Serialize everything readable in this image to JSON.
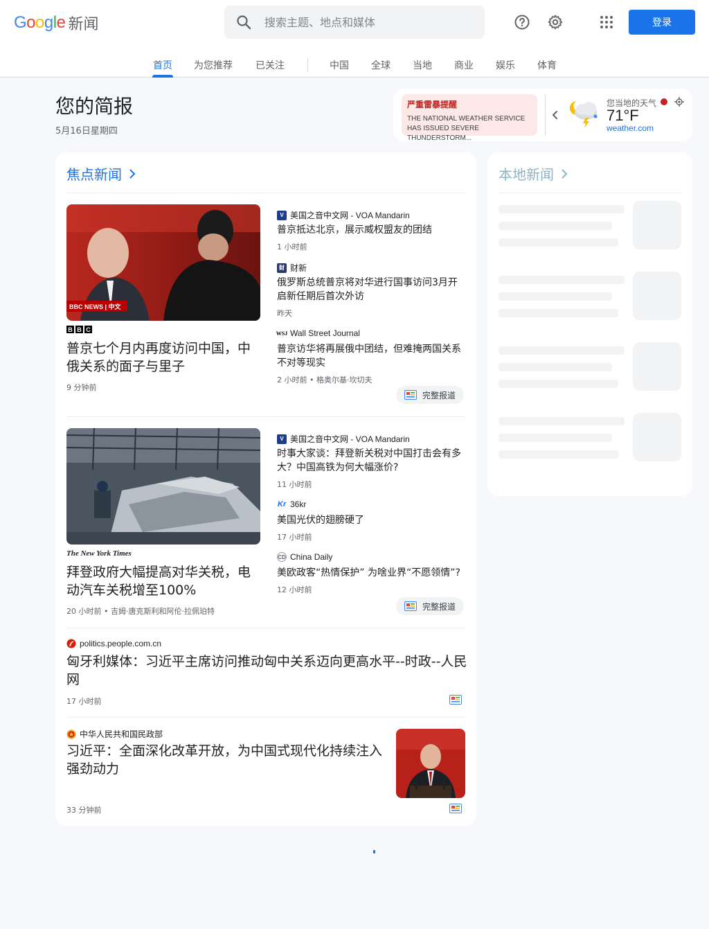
{
  "brand": {
    "google": "Google",
    "product": "新闻"
  },
  "search": {
    "placeholder": "搜索主题、地点和媒体"
  },
  "header": {
    "signin_label": "登录"
  },
  "tabs": [
    {
      "label": "首页",
      "active": true
    },
    {
      "label": "为您推荐"
    },
    {
      "label": "已关注"
    },
    {
      "label": "中国"
    },
    {
      "label": "全球"
    },
    {
      "label": "当地"
    },
    {
      "label": "商业"
    },
    {
      "label": "娱乐"
    },
    {
      "label": "体育"
    }
  ],
  "briefing": {
    "title": "您的简报",
    "date": "5月16日星期四"
  },
  "weather": {
    "alert_title": "严重雷暴提醒",
    "alert_desc": "THE NATIONAL WEATHER SERVICE HAS ISSUED SEVERE THUNDERSTORM...",
    "label": "您当地的天气",
    "temp": "71°F",
    "source": "weather.com"
  },
  "top_stories": {
    "heading": "焦点新闻",
    "full_coverage_label": "完整报道",
    "clusters": [
      {
        "main": {
          "publisher": "BBC",
          "title": "普京七个月内再度访问中国，中俄关系的面子与里子",
          "time": "9 分钟前",
          "image_caption": "BBC NEWS | 中文"
        },
        "related": [
          {
            "publisher": "美国之音中文网 - VOA Mandarin",
            "title": "普京抵达北京，展示威权盟友的团结",
            "meta": "1 小时前"
          },
          {
            "publisher": "财新",
            "title": "俄罗斯总统普京将对华进行国事访问3月开启新任期后首次外访",
            "meta": "昨天"
          },
          {
            "publisher": "Wall Street Journal",
            "title": "普京访华将再展俄中团结，但难掩两国关系不对等现实",
            "meta": "2 小时前 • 格奥尔基·坎切夫"
          }
        ]
      },
      {
        "main": {
          "publisher": "The New York Times",
          "title": "拜登政府大幅提高对华关税，电动汽车关税增至100%",
          "time": "20 小时前 • 吉姆·唐克斯利和阿伦·拉佩珀特"
        },
        "related": [
          {
            "publisher": "美国之音中文网 - VOA Mandarin",
            "title": "时事大家谈：拜登新关税对中国打击会有多大？中国高铁为何大幅涨价?",
            "meta": "11 小时前"
          },
          {
            "publisher": "36kr",
            "title": "美国光伏的翅膀硬了",
            "meta": "17 小时前"
          },
          {
            "publisher": "China Daily",
            "title": "美欧政客“热情保护” 为啥业界“不愿领情”?",
            "meta": "12 小时前"
          }
        ]
      }
    ],
    "singles": [
      {
        "publisher": "politics.people.com.cn",
        "title": "匈牙利媒体：习近平主席访问推动匈中关系迈向更高水平--时政--人民网",
        "time": "17 小时前"
      },
      {
        "publisher": "中华人民共和国民政部",
        "title": "习近平：全面深化改革开放，为中国式现代化持续注入强劲动力",
        "time": "33 分钟前"
      }
    ]
  },
  "local": {
    "heading": "本地新闻"
  },
  "colors": {
    "accent": "#1a73e8",
    "alert": "#c5221f",
    "alert_bg": "#fce8e6"
  }
}
